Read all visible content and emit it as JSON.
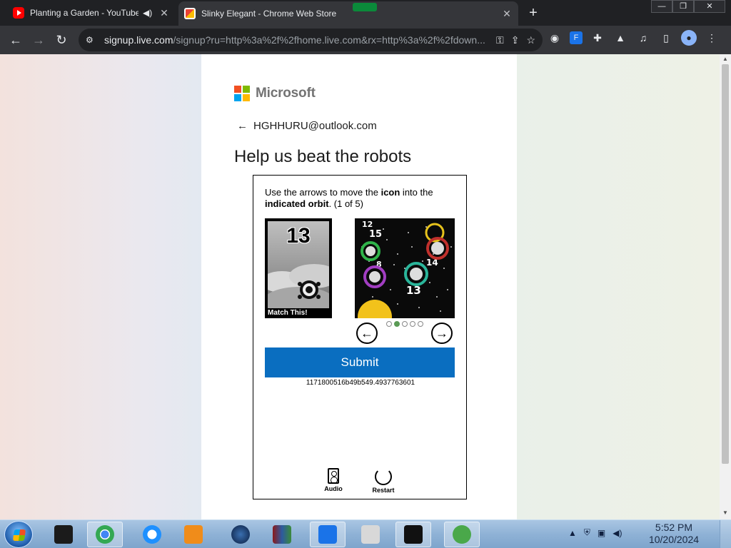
{
  "browser": {
    "tabs": [
      {
        "title": "Planting a Garden - YouTube",
        "favicon": "youtube-icon",
        "audio": true,
        "active": false
      },
      {
        "title": "Slinky Elegant - Chrome Web Store",
        "title_tail": "beat the robots",
        "favicon": "chrome-web-store-icon",
        "active": true
      }
    ],
    "url_host": "signup.live.com",
    "url_path": "/signup?ru=http%3a%2f%2fhome.live.com&rx=http%3a%2f%2fdown..."
  },
  "page": {
    "brand": "Microsoft",
    "brand_colors": [
      "#f25022",
      "#7fba00",
      "#00a4ef",
      "#ffb900"
    ],
    "identity_email": "HGHHURU@outlook.com",
    "heading": "Help us beat the robots",
    "challenge": {
      "instruction_part1": "Use the arrows to move the ",
      "instruction_bold1": "icon",
      "instruction_part2": " into the ",
      "instruction_bold2": "indicated orbit",
      "instruction_part3": ". (1 of 5)",
      "match_number": "13",
      "match_caption": "Match This!",
      "orbit_labels": [
        "12",
        "15",
        "8",
        "14",
        "13"
      ],
      "dots_total": 5,
      "dots_active_index": 1,
      "submit_label": "Submit",
      "session_id": "1171800516b49b549.4937763601",
      "audio_label": "Audio",
      "restart_label": "Restart"
    }
  },
  "taskbar": {
    "clock_time": "5:52 PM",
    "clock_date": "10/20/2024"
  }
}
